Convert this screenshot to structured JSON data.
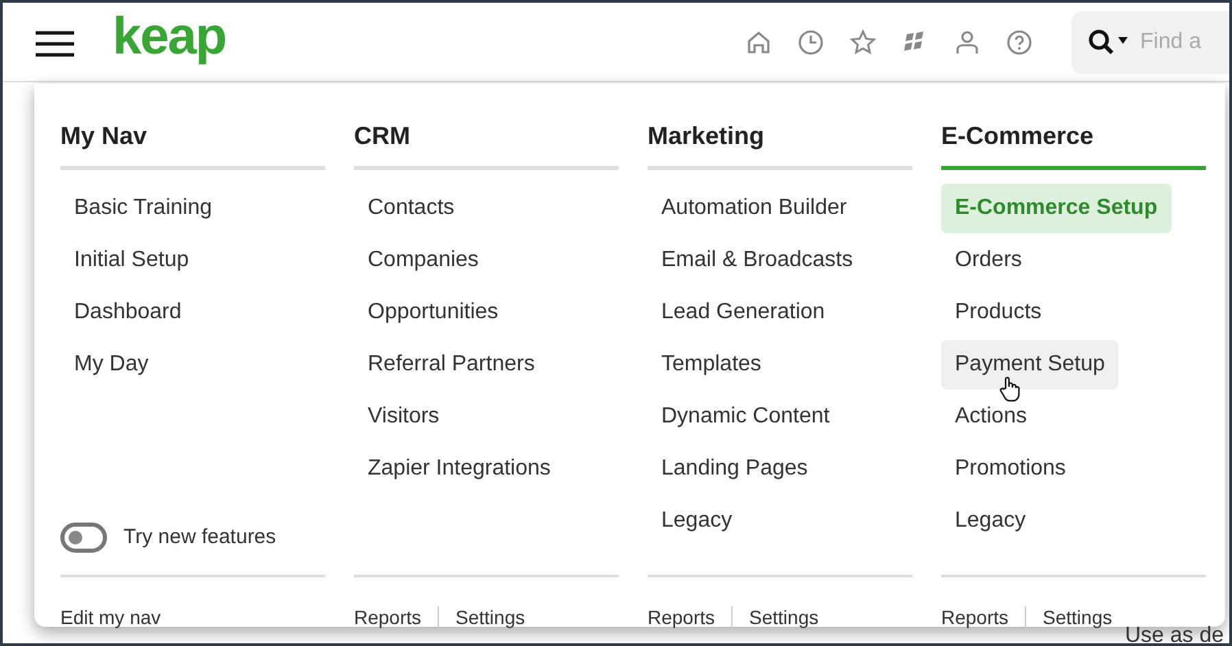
{
  "header": {
    "logo": "keap",
    "icons": [
      {
        "kind": "home"
      },
      {
        "kind": "clock"
      },
      {
        "kind": "star"
      },
      {
        "kind": "tiles"
      },
      {
        "kind": "person"
      },
      {
        "kind": "help"
      }
    ],
    "search": {
      "placeholder": "Find a"
    }
  },
  "page_background": {
    "text": "Use as de"
  },
  "menu": {
    "columns": [
      {
        "title": "My Nav",
        "active": false,
        "items": [
          {
            "label": "Basic Training",
            "selected": false,
            "hovered": false
          },
          {
            "label": "Initial Setup",
            "selected": false,
            "hovered": false
          },
          {
            "label": "Dashboard",
            "selected": false,
            "hovered": false
          },
          {
            "label": "My Day",
            "selected": false,
            "hovered": false
          }
        ],
        "toggle": {
          "label": "Try new features",
          "on": false
        },
        "footer": [
          "Edit my nav"
        ]
      },
      {
        "title": "CRM",
        "active": false,
        "items": [
          {
            "label": "Contacts",
            "selected": false,
            "hovered": false
          },
          {
            "label": "Companies",
            "selected": false,
            "hovered": false
          },
          {
            "label": "Opportunities",
            "selected": false,
            "hovered": false
          },
          {
            "label": "Referral Partners",
            "selected": false,
            "hovered": false
          },
          {
            "label": "Visitors",
            "selected": false,
            "hovered": false
          },
          {
            "label": "Zapier Integrations",
            "selected": false,
            "hovered": false
          }
        ],
        "footer": [
          "Reports",
          "Settings"
        ]
      },
      {
        "title": "Marketing",
        "active": false,
        "items": [
          {
            "label": "Automation Builder",
            "selected": false,
            "hovered": false
          },
          {
            "label": "Email & Broadcasts",
            "selected": false,
            "hovered": false
          },
          {
            "label": "Lead Generation",
            "selected": false,
            "hovered": false
          },
          {
            "label": "Templates",
            "selected": false,
            "hovered": false
          },
          {
            "label": "Dynamic Content",
            "selected": false,
            "hovered": false
          },
          {
            "label": "Landing Pages",
            "selected": false,
            "hovered": false
          },
          {
            "label": "Legacy",
            "selected": false,
            "hovered": false
          }
        ],
        "footer": [
          "Reports",
          "Settings"
        ]
      },
      {
        "title": "E-Commerce",
        "active": true,
        "items": [
          {
            "label": "E-Commerce Setup",
            "selected": true,
            "hovered": false
          },
          {
            "label": "Orders",
            "selected": false,
            "hovered": false
          },
          {
            "label": "Products",
            "selected": false,
            "hovered": false
          },
          {
            "label": "Payment Setup",
            "selected": false,
            "hovered": true
          },
          {
            "label": "Actions",
            "selected": false,
            "hovered": false
          },
          {
            "label": "Promotions",
            "selected": false,
            "hovered": false
          },
          {
            "label": "Legacy",
            "selected": false,
            "hovered": false
          }
        ],
        "footer": [
          "Reports",
          "Settings"
        ]
      }
    ]
  }
}
